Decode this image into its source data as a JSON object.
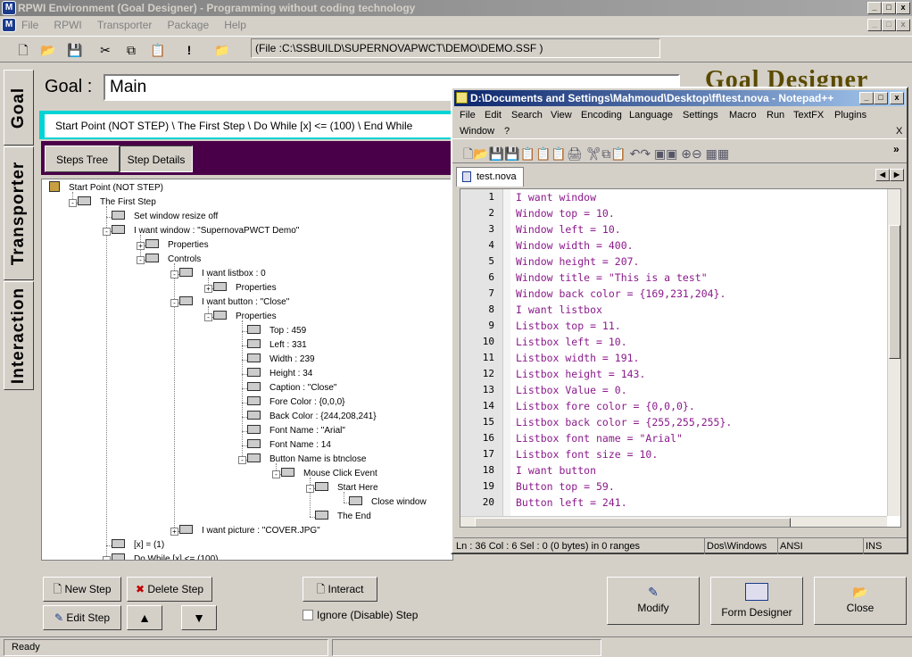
{
  "window": {
    "title": "RPWI Environment (Goal Designer) - Programming without coding technology",
    "controls": [
      "_",
      "□",
      "x"
    ]
  },
  "menu": [
    "File",
    "RPWI",
    "Transporter",
    "Package",
    "Help"
  ],
  "toolbar": {
    "path": "(File :C:\\SSBUILD\\SUPERNOVAPWCT\\DEMO\\DEMO.SSF )",
    "icons": [
      "new-file-icon",
      "open-folder-icon",
      "save-icon",
      "cut-icon",
      "copy-icon",
      "paste-icon",
      "run-icon",
      "open-icon"
    ]
  },
  "side_tabs": [
    "Goal",
    "Transporter",
    "Interaction"
  ],
  "goal": {
    "label": "Goal :",
    "value": "Main",
    "brand": "Goal Designer"
  },
  "breadcrumb": "Start Point (NOT STEP)  \\  The First Step  \\  Do While [x] <= (100)  \\  End While",
  "tabs": [
    "Steps Tree",
    "Step Details"
  ],
  "tree": [
    {
      "label": "Start Point (NOT STEP)",
      "level": 0,
      "exp": ""
    },
    {
      "label": "The First Step",
      "level": 1,
      "exp": "-"
    },
    {
      "label": "Set window resize off",
      "level": 2,
      "exp": ""
    },
    {
      "label": "I want window : \"SupernovaPWCT Demo\"",
      "level": 2,
      "exp": "-"
    },
    {
      "label": "Properties",
      "level": 3,
      "exp": "+"
    },
    {
      "label": "Controls",
      "level": 3,
      "exp": "-"
    },
    {
      "label": "I want listbox : 0",
      "level": 4,
      "exp": "-"
    },
    {
      "label": "Properties",
      "level": 5,
      "exp": "+"
    },
    {
      "label": "I want button : \"Close\"",
      "level": 4,
      "exp": "-"
    },
    {
      "label": "Properties",
      "level": 5,
      "exp": "-"
    },
    {
      "label": "Top : 459",
      "level": 6,
      "exp": ""
    },
    {
      "label": "Left : 331",
      "level": 6,
      "exp": ""
    },
    {
      "label": "Width : 239",
      "level": 6,
      "exp": ""
    },
    {
      "label": "Height : 34",
      "level": 6,
      "exp": ""
    },
    {
      "label": "Caption : \"Close\"",
      "level": 6,
      "exp": ""
    },
    {
      "label": "Fore Color : {0,0,0}",
      "level": 6,
      "exp": ""
    },
    {
      "label": "Back Color : {244,208,241}",
      "level": 6,
      "exp": ""
    },
    {
      "label": "Font Name : \"Arial\"",
      "level": 6,
      "exp": ""
    },
    {
      "label": "Font Name : 14",
      "level": 6,
      "exp": ""
    },
    {
      "label": "Button Name is btnclose",
      "level": 6,
      "exp": "-"
    },
    {
      "label": "Mouse Click Event",
      "level": 7,
      "exp": "-"
    },
    {
      "label": "Start Here",
      "level": 8,
      "exp": "-"
    },
    {
      "label": "Close window",
      "level": 9,
      "exp": ""
    },
    {
      "label": "The End",
      "level": 8,
      "exp": ""
    },
    {
      "label": "I want picture : \"COVER.JPG\"",
      "level": 4,
      "exp": "+"
    },
    {
      "label": "[x] = (1)",
      "level": 2,
      "exp": ""
    },
    {
      "label": "Do While [x] <= (100)",
      "level": 2,
      "exp": "-"
    }
  ],
  "buttons": {
    "new_step": "New Step",
    "delete_step": "Delete Step",
    "edit_step": "Edit Step",
    "interact": "Interact",
    "ignore": "Ignore (Disable) Step",
    "modify": "Modify",
    "form_designer": "Form Designer",
    "close": "Close"
  },
  "status": "Ready",
  "notepad": {
    "title": "D:\\Documents and Settings\\Mahmoud\\Desktop\\ff\\test.nova - Notepad++",
    "menu": [
      "File",
      "Edit",
      "Search",
      "View",
      "Encoding",
      "Language",
      "Settings",
      "Macro",
      "Run",
      "TextFX",
      "Plugins",
      "Window",
      "?"
    ],
    "menu_close": "X",
    "tab": "test.nova",
    "lines": [
      "I want window",
      "Window top = 10.",
      "Window left = 10.",
      "Window width = 400.",
      "Window height = 207.",
      "Window title = \"This is a test\"",
      "Window back color = {169,231,204}.",
      "I want listbox",
      "Listbox top = 11.",
      "Listbox left = 10.",
      "Listbox width = 191.",
      "Listbox height = 143.",
      "Listbox Value = 0.",
      "Listbox fore color = {0,0,0}.",
      "Listbox back color = {255,255,255}.",
      "Listbox font name = \"Arial\"",
      "Listbox font size = 10.",
      "I want button",
      "Button top = 59.",
      "Button left = 241."
    ],
    "status": {
      "pos": "Ln : 36    Col : 6    Sel : 0 (0 bytes) in 0 ranges",
      "eol": "Dos\\Windows",
      "enc": "ANSI",
      "mode": "INS"
    }
  }
}
